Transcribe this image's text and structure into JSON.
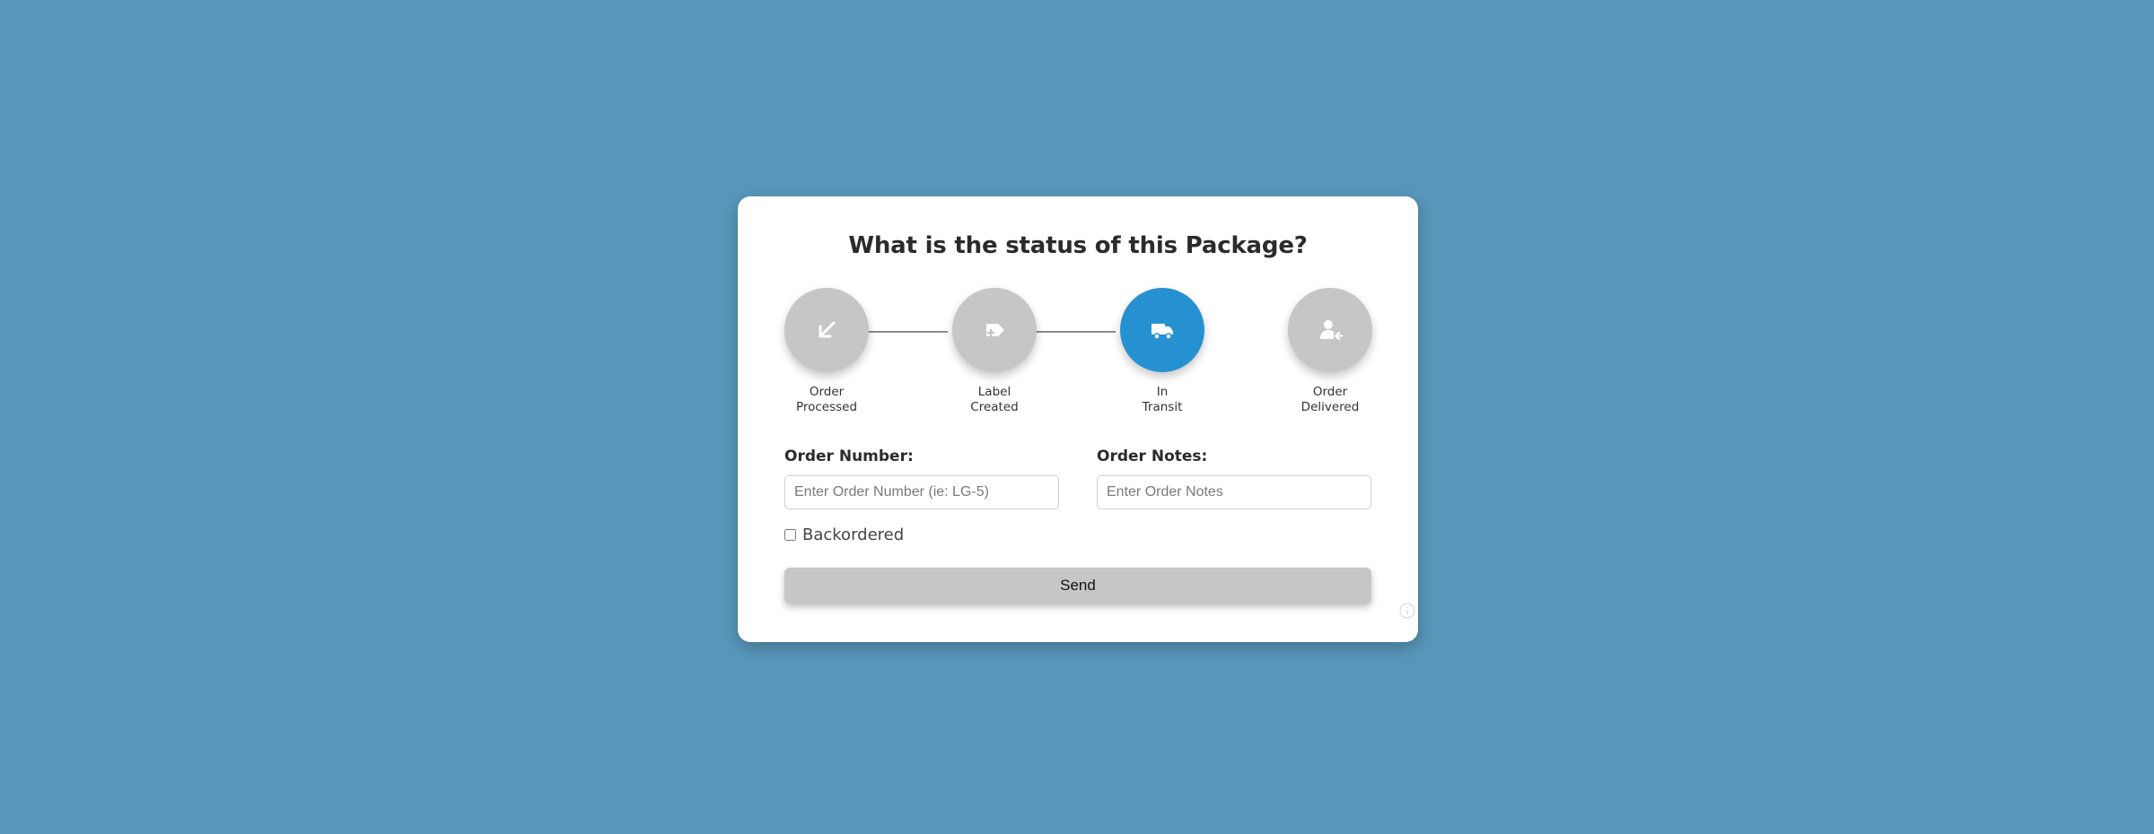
{
  "form": {
    "title": "What is the status of this Package?",
    "steps": [
      {
        "label_line1": "Order",
        "label_line2": "Processed",
        "icon": "arrow-down-left-icon",
        "active": false
      },
      {
        "label_line1": "Label",
        "label_line2": "Created",
        "icon": "tag-plus-icon",
        "active": false
      },
      {
        "label_line1": "In",
        "label_line2": "Transit",
        "icon": "truck-icon",
        "active": true
      },
      {
        "label_line1": "Order",
        "label_line2": "Delivered",
        "icon": "user-arrow-icon",
        "active": false
      }
    ],
    "order_number": {
      "label": "Order Number:",
      "placeholder": "Enter Order Number (ie: LG-5)",
      "value": ""
    },
    "order_notes": {
      "label": "Order Notes:",
      "placeholder": "Enter Order Notes",
      "value": ""
    },
    "backordered": {
      "label": "Backordered",
      "checked": false
    },
    "send_label": "Send"
  },
  "colors": {
    "background": "#5897bb",
    "active_step": "#2591d0",
    "inactive_step": "#c6c6c6"
  }
}
